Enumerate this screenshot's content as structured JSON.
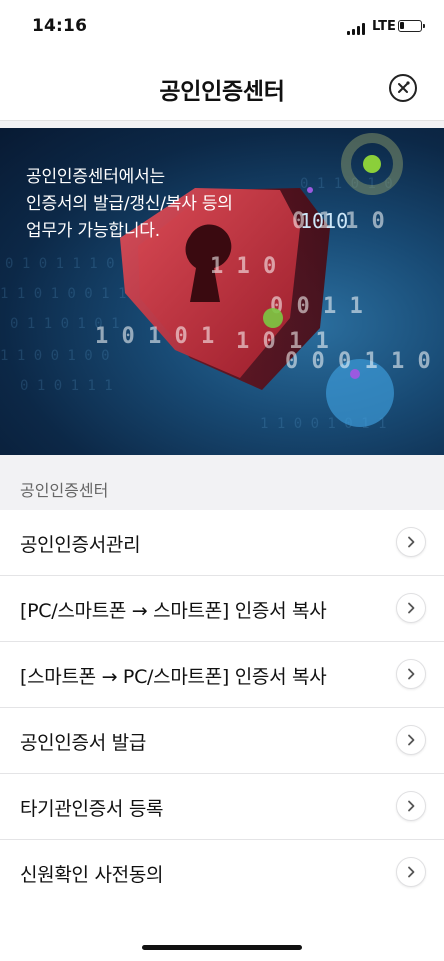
{
  "status_bar": {
    "time": "14:16",
    "network": "LTE",
    "battery_level": 0.2
  },
  "nav": {
    "title": "공인인증센터",
    "close_icon": "close-circle-icon"
  },
  "banner": {
    "lines": [
      "공인인증센터에서는",
      "인증서의 발급/갱신/복사 등의",
      "업무가 가능합니다."
    ],
    "image": "shield-keyhole-binary-illustration",
    "binary_text": [
      "1010",
      "0101",
      "1110",
      "0100",
      "1011"
    ]
  },
  "section": {
    "title": "공인인증센터"
  },
  "menu": {
    "items": [
      {
        "label": "공인인증서관리"
      },
      {
        "label": "[PC/스마트폰 → 스마트폰] 인증서 복사"
      },
      {
        "label": "[스마트폰 → PC/스마트폰] 인증서 복사"
      },
      {
        "label": "공인인증서 발급"
      },
      {
        "label": "타기관인증서 등록"
      },
      {
        "label": "신원확인 사전동의"
      }
    ],
    "chevron_icon": "chevron-right-icon"
  },
  "colors": {
    "shield": "#c8323f",
    "banner_bg": "#0c2847",
    "accent_green": "#8bcf3a",
    "accent_purple": "#8c4fd6"
  }
}
